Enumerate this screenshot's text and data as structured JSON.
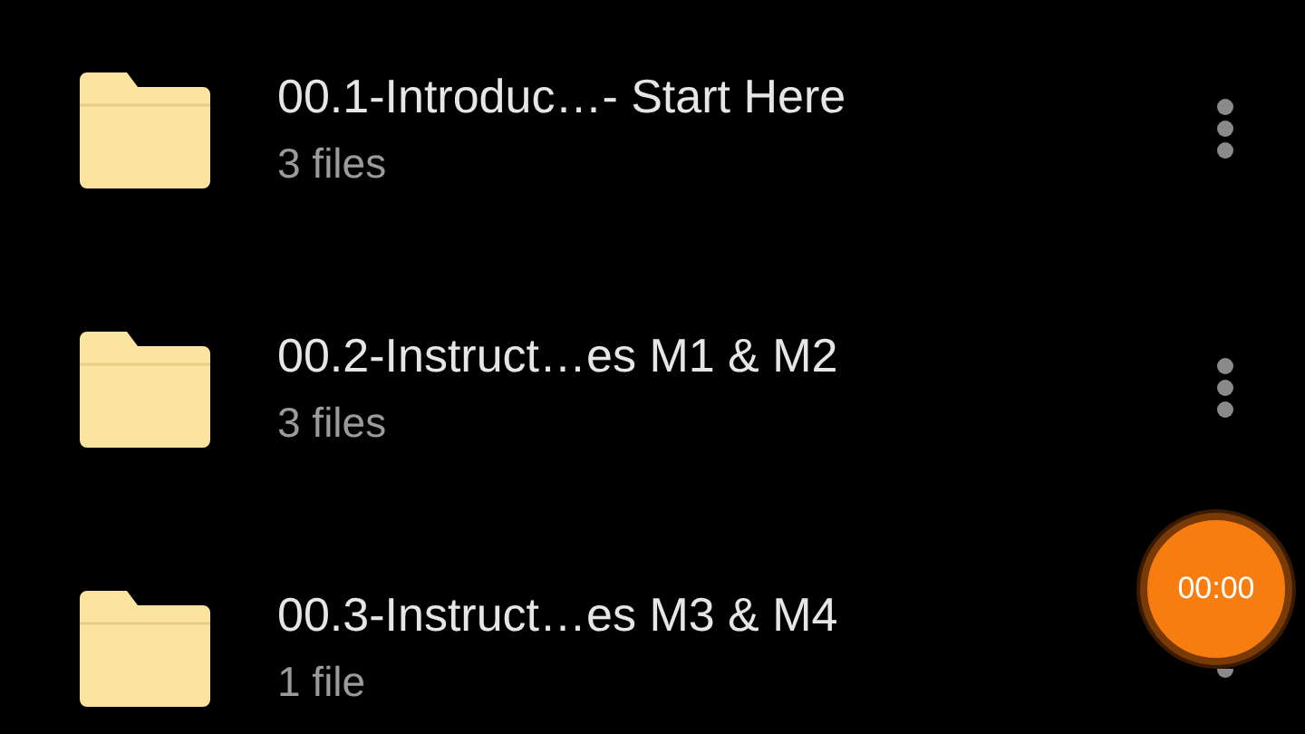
{
  "folders": [
    {
      "name": "00.1-Introduc…- Start Here",
      "count": "3 files"
    },
    {
      "name": "00.2-Instruct…es M1 & M2",
      "count": "3 files"
    },
    {
      "name": "00.3-Instruct…es M3 & M4",
      "count": "1 file"
    }
  ],
  "recorder": {
    "time": "00:00"
  }
}
